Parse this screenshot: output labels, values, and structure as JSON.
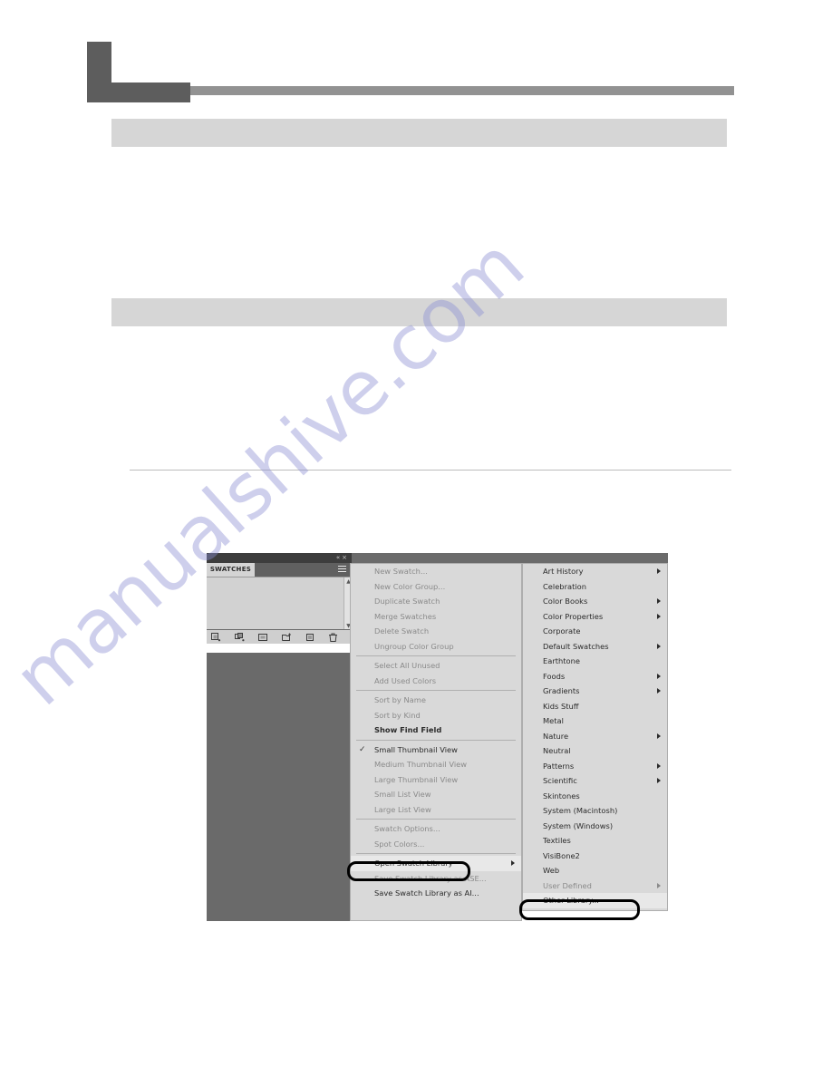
{
  "page": {
    "watermark_text": "manualshive.com",
    "accent_dark": "#5d5d5d",
    "accent_rule": "#929292",
    "banner_color": "#d6d6d6",
    "callout_color": "#000000",
    "canvas_color": "#6a6a6a",
    "menu_bg": "#d9d9d9",
    "banner_1_text": "",
    "banner_2_text": ""
  },
  "panel": {
    "tab_label": "SWATCHES",
    "collapse_icon": "«",
    "close_icon": "×",
    "menu_icon": "panel-menu-icon",
    "scroll_up": "▲",
    "scroll_down": "▼",
    "footer_buttons": [
      {
        "name": "swatch-libraries-menu-button"
      },
      {
        "name": "show-swatch-kinds-menu-button"
      },
      {
        "name": "swatch-options-button"
      },
      {
        "name": "new-color-group-button"
      },
      {
        "name": "new-swatch-button"
      },
      {
        "name": "delete-swatch-button"
      }
    ]
  },
  "flyout_menu": {
    "items": [
      {
        "label": "New Swatch...",
        "dim": true,
        "bold": false,
        "check": false,
        "arrow": false
      },
      {
        "label": "New Color Group...",
        "dim": true,
        "bold": false,
        "check": false,
        "arrow": false
      },
      {
        "label": "Duplicate Swatch",
        "dim": true,
        "bold": false,
        "check": false,
        "arrow": false
      },
      {
        "label": "Merge Swatches",
        "dim": true,
        "bold": false,
        "check": false,
        "arrow": false
      },
      {
        "label": "Delete Swatch",
        "dim": true,
        "bold": false,
        "check": false,
        "arrow": false
      },
      {
        "label": "Ungroup Color Group",
        "dim": true,
        "bold": false,
        "check": false,
        "arrow": false
      },
      {
        "separator": true
      },
      {
        "label": "Select All Unused",
        "dim": true,
        "bold": false,
        "check": false,
        "arrow": false
      },
      {
        "label": "Add Used Colors",
        "dim": true,
        "bold": false,
        "check": false,
        "arrow": false
      },
      {
        "separator": true
      },
      {
        "label": "Sort by Name",
        "dim": true,
        "bold": false,
        "check": false,
        "arrow": false
      },
      {
        "label": "Sort by Kind",
        "dim": true,
        "bold": false,
        "check": false,
        "arrow": false
      },
      {
        "label": "Show Find Field",
        "dim": false,
        "bold": true,
        "check": false,
        "arrow": false
      },
      {
        "separator": true
      },
      {
        "label": "Small Thumbnail View",
        "dim": false,
        "bold": false,
        "check": true,
        "arrow": false
      },
      {
        "label": "Medium Thumbnail View",
        "dim": true,
        "bold": false,
        "check": false,
        "arrow": false
      },
      {
        "label": "Large Thumbnail View",
        "dim": true,
        "bold": false,
        "check": false,
        "arrow": false
      },
      {
        "label": "Small List View",
        "dim": true,
        "bold": false,
        "check": false,
        "arrow": false
      },
      {
        "label": "Large List View",
        "dim": true,
        "bold": false,
        "check": false,
        "arrow": false
      },
      {
        "separator": true
      },
      {
        "label": "Swatch Options...",
        "dim": true,
        "bold": false,
        "check": false,
        "arrow": false
      },
      {
        "label": "Spot Colors...",
        "dim": true,
        "bold": false,
        "check": false,
        "arrow": false
      },
      {
        "separator": true
      },
      {
        "label": "Open Swatch Library",
        "dim": false,
        "bold": false,
        "check": false,
        "arrow": true,
        "highlight": true
      },
      {
        "label": "Save Swatch Library as ASE...",
        "dim": true,
        "bold": false,
        "check": false,
        "arrow": false
      },
      {
        "label": "Save Swatch Library as AI...",
        "dim": false,
        "bold": false,
        "check": false,
        "arrow": false
      }
    ]
  },
  "submenu": {
    "items": [
      {
        "label": "Art History",
        "dim": false,
        "arrow": true
      },
      {
        "label": "Celebration",
        "dim": false,
        "arrow": false
      },
      {
        "label": "Color Books",
        "dim": false,
        "arrow": true
      },
      {
        "label": "Color Properties",
        "dim": false,
        "arrow": true
      },
      {
        "label": "Corporate",
        "dim": false,
        "arrow": false
      },
      {
        "label": "Default Swatches",
        "dim": false,
        "arrow": true
      },
      {
        "label": "Earthtone",
        "dim": false,
        "arrow": false
      },
      {
        "label": "Foods",
        "dim": false,
        "arrow": true
      },
      {
        "label": "Gradients",
        "dim": false,
        "arrow": true
      },
      {
        "label": "Kids Stuff",
        "dim": false,
        "arrow": false
      },
      {
        "label": "Metal",
        "dim": false,
        "arrow": false
      },
      {
        "label": "Nature",
        "dim": false,
        "arrow": true
      },
      {
        "label": "Neutral",
        "dim": false,
        "arrow": false
      },
      {
        "label": "Patterns",
        "dim": false,
        "arrow": true
      },
      {
        "label": "Scientific",
        "dim": false,
        "arrow": true
      },
      {
        "label": "Skintones",
        "dim": false,
        "arrow": false
      },
      {
        "label": "System (Macintosh)",
        "dim": false,
        "arrow": false
      },
      {
        "label": "System (Windows)",
        "dim": false,
        "arrow": false
      },
      {
        "label": "Textiles",
        "dim": false,
        "arrow": false
      },
      {
        "label": "VisiBone2",
        "dim": false,
        "arrow": false
      },
      {
        "label": "Web",
        "dim": false,
        "arrow": false
      },
      {
        "label": "User Defined",
        "dim": true,
        "arrow": true
      },
      {
        "label": "Other Library...",
        "dim": false,
        "arrow": false,
        "highlight": true
      }
    ]
  },
  "callouts": [
    {
      "target": "Open Swatch Library"
    },
    {
      "target": "Other Library..."
    }
  ]
}
